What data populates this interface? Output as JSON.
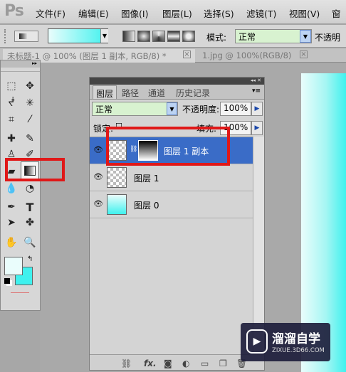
{
  "app": {
    "logo": "Ps"
  },
  "menu": [
    "文件(F)",
    "编辑(E)",
    "图像(I)",
    "图层(L)",
    "选择(S)",
    "滤镜(T)",
    "视图(V)",
    "窗"
  ],
  "options": {
    "mode_label": "模式:",
    "mode_value": "正常",
    "opacity_label": "不透明"
  },
  "doc_tabs": [
    "未标题-1 @ 100% (图层 1 副本, RGB/8) *",
    "1.jpg @ 100%(RGB/8)"
  ],
  "toolbox": {
    "tools": [
      "marquee",
      "move",
      "lasso",
      "magic-wand",
      "crop",
      "eyedropper",
      "healing",
      "brush",
      "stamp",
      "history-brush",
      "eraser",
      "gradient",
      "blur",
      "dodge",
      "pen",
      "type",
      "path-select",
      "shape",
      "hand",
      "zoom"
    ],
    "fg_color": "#eafdfc",
    "bg_color": "#3ff1ee"
  },
  "panel": {
    "tabs": [
      "图层",
      "路径",
      "通道",
      "历史记录"
    ],
    "blend_mode": "正常",
    "opacity_label": "不透明度:",
    "opacity_value": "100%",
    "lock_label": "锁定:",
    "fill_label": "填充:",
    "fill_value": "100%",
    "layers": [
      {
        "name": "图层 1 副本",
        "selected": true,
        "has_mask": true
      },
      {
        "name": "图层 1",
        "selected": false,
        "has_mask": false
      },
      {
        "name": "图层 0",
        "selected": false,
        "has_mask": false
      }
    ],
    "footer_icons": [
      "link-icon",
      "fx-icon",
      "mask-icon",
      "adjustment-icon",
      "group-icon",
      "new-layer-icon",
      "trash-icon"
    ],
    "footer_fx": "fx."
  },
  "watermark": {
    "title": "溜溜自学",
    "url": "ZIXUE.3D66.COM"
  },
  "colors": {
    "highlight": "#e01818",
    "selection": "#3a6cc7",
    "accent_cyan": "#3ff1ee"
  }
}
